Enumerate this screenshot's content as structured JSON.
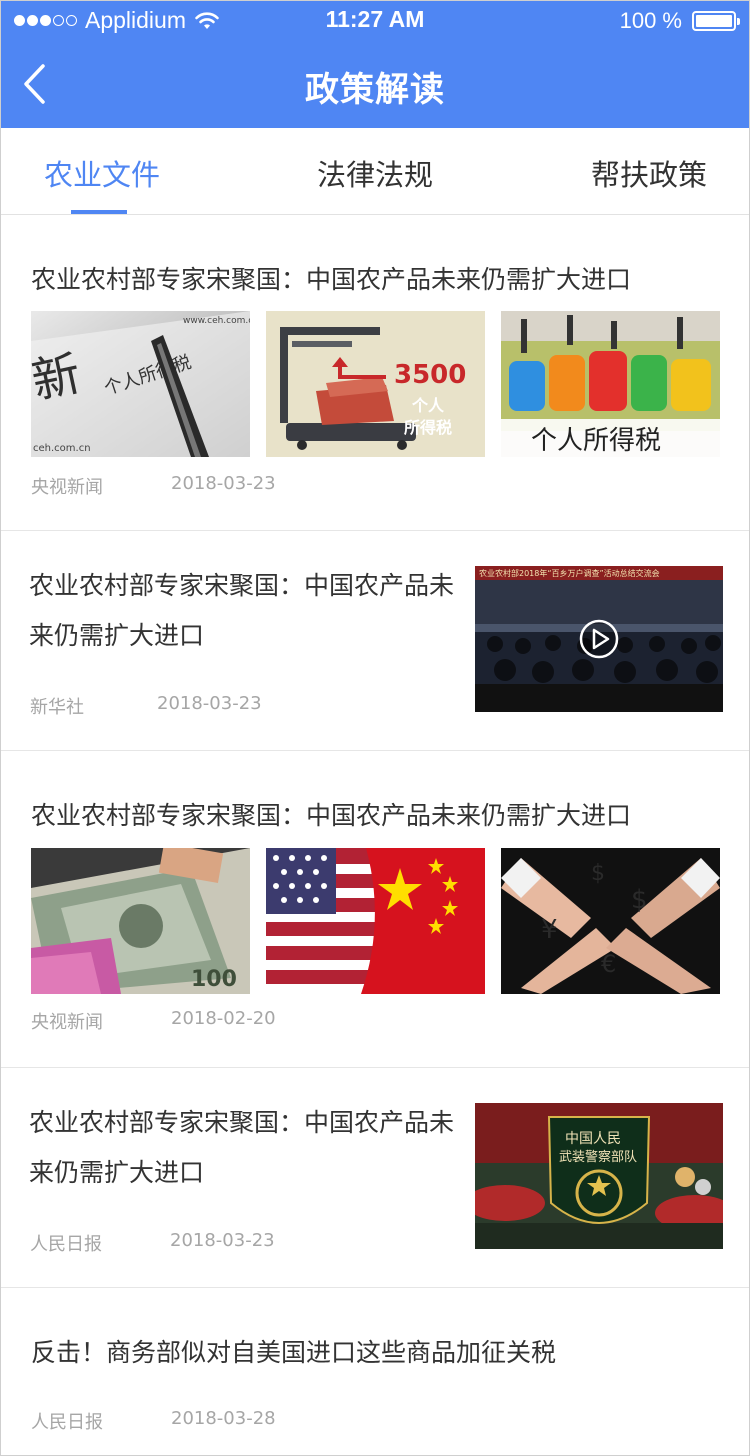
{
  "status_bar": {
    "carrier": "Applidium",
    "time": "11:27 AM",
    "battery": "100 %"
  },
  "nav": {
    "title": "政策解读",
    "back_icon": "chevron-left-icon"
  },
  "tabs": [
    {
      "label": "农业文件",
      "active": true
    },
    {
      "label": "法律法规",
      "active": false
    },
    {
      "label": "帮扶政策",
      "active": false
    }
  ],
  "articles": [
    {
      "title": "农业农村部专家宋聚国：中国农产品未来仍需扩大进口",
      "source": "央视新闻",
      "date": "2018-03-23",
      "layout": "three-images"
    },
    {
      "title": "农业农村部专家宋聚国：中国农产品未来仍需扩大进口",
      "source": "新华社",
      "date": "2018-03-23",
      "layout": "right-image-video"
    },
    {
      "title": "农业农村部专家宋聚国：中国农产品未来仍需扩大进口",
      "source": "央视新闻",
      "date": "2018-02-20",
      "layout": "three-images"
    },
    {
      "title": "农业农村部专家宋聚国：中国农产品未来仍需扩大进口",
      "source": "人民日报",
      "date": "2018-03-23",
      "layout": "right-image"
    },
    {
      "title": "反击！商务部似对自美国进口这些商品加征关税",
      "source": "人民日报",
      "date": "2018-03-28",
      "layout": "text-only"
    }
  ],
  "image_texts": {
    "tax_newspaper": "个人所得税",
    "tax_newspaper_big": "新",
    "tax_newspaper_site": "www.ceh.com.cn",
    "tax_newspaper_site2": "ceh.com.cn",
    "scale_number": "3500",
    "scale_caption_1": "个人",
    "scale_caption_2": "所得税",
    "blocks_caption": "个人所得税",
    "meeting_banner": "农业农村部2018年“百乡万户调查”活动总结交流会",
    "badge_line_1": "中国人民",
    "badge_line_2": "武装警察部队"
  },
  "colors": {
    "brand_blue": "#4f86f3",
    "meta_gray": "#a6a6a6",
    "divider": "#e6e6e6"
  }
}
